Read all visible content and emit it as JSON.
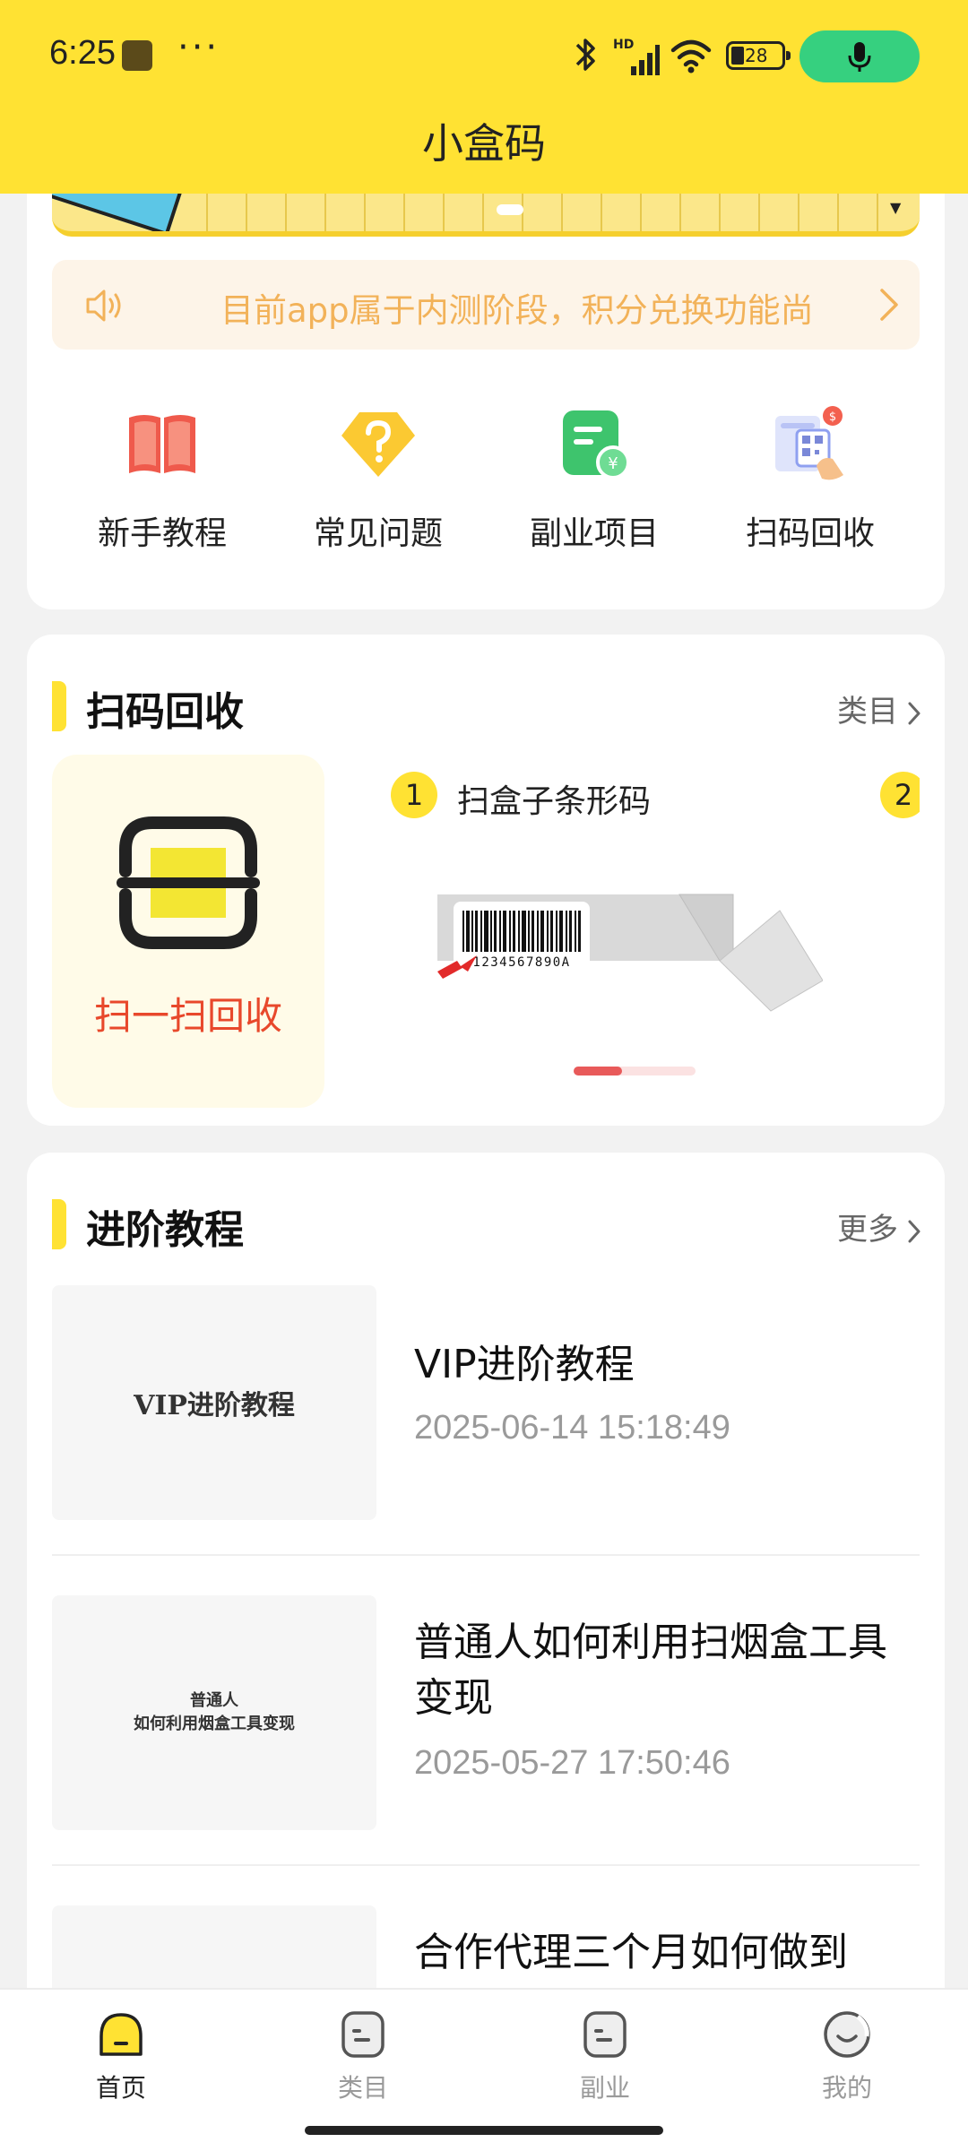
{
  "status_bar": {
    "time": "6:25",
    "dots": "···",
    "network_label": "HD",
    "battery": "28"
  },
  "header": {
    "title": "小盒码"
  },
  "notice": {
    "text": "目前app属于内测阶段，积分兑换功能尚"
  },
  "quick_actions": [
    {
      "label": "新手教程",
      "icon": "book-icon",
      "color": "#ef5a4c"
    },
    {
      "label": "常见问题",
      "icon": "question-icon",
      "color": "#fbc932"
    },
    {
      "label": "副业项目",
      "icon": "side-job-icon",
      "color": "#3ec46d"
    },
    {
      "label": "扫码回收",
      "icon": "qr-scan-icon",
      "color": "#8fa0f0"
    }
  ],
  "scan_section": {
    "title": "扫码回收",
    "more": "类目",
    "scan_label": "扫一扫回收",
    "steps": [
      {
        "num": "1",
        "text": "扫盒子条形码"
      },
      {
        "num": "2",
        "text": ""
      }
    ],
    "barcode_number": "1234567890A",
    "carousel_progress": 0.4
  },
  "tutorials": {
    "title": "进阶教程",
    "more": "更多",
    "items": [
      {
        "thumb_text": "VIP进阶教程",
        "title": "VIP进阶教程",
        "date": "2025-06-14 15:18:49"
      },
      {
        "thumb_line1": "普通人",
        "thumb_line2": "如何利用烟盒工具变现",
        "title": "普通人如何利用扫烟盒工具变现",
        "date": "2025-05-27 17:50:46"
      },
      {
        "title": "合作代理三个月如何做到"
      }
    ]
  },
  "bottom_nav": [
    {
      "label": "首页",
      "icon": "home-icon",
      "active": true
    },
    {
      "label": "类目",
      "icon": "category-icon",
      "active": false
    },
    {
      "label": "副业",
      "icon": "side-job-tab-icon",
      "active": false
    },
    {
      "label": "我的",
      "icon": "profile-icon",
      "active": false
    }
  ],
  "colors": {
    "brand_yellow": "#ffe233",
    "notice_text": "#f2b259",
    "scan_label": "#e8482b",
    "mic_green": "#36d07f"
  }
}
